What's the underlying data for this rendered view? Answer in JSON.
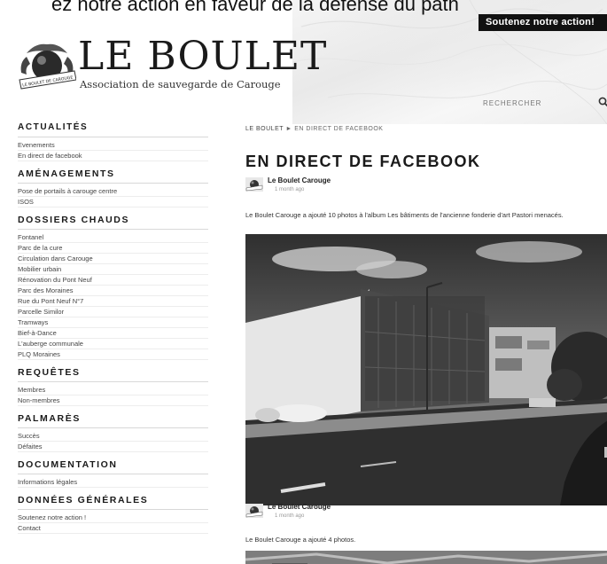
{
  "header": {
    "top_caption": "ez notre action en faveur de la défense du path",
    "support_button": "Soutenez notre action!",
    "logo_title": "LE BOULET",
    "logo_subtitle": "Association de sauvegarde de Carouge",
    "search_placeholder": "RECHERCHER",
    "seal_text": "LE BOULET DE CAROUGE"
  },
  "sidebar": {
    "sections": [
      {
        "title": "ACTUALITÉS",
        "items": [
          "Evenements",
          "En direct de facebook"
        ]
      },
      {
        "title": "AMÉNAGEMENTS",
        "items": [
          "Pose de portails à carouge centre",
          "ISOS"
        ]
      },
      {
        "title": "DOSSIERS CHAUDS",
        "items": [
          "Fontanel",
          "Parc de la cure",
          "Circulation dans Carouge",
          "Mobilier urbain",
          "Rénovation du Pont Neuf",
          "Parc des Moraines",
          "Rue du Pont Neuf N°7",
          "Parcelle Similor",
          "Tramways",
          "Bief-à-Dance",
          "L'auberge communale",
          "PLQ Moraines"
        ]
      },
      {
        "title": "REQUÊTES",
        "items": [
          "Membres",
          "Non-membres"
        ]
      },
      {
        "title": "PALMARÈS",
        "items": [
          "Succès",
          "Défaites"
        ]
      },
      {
        "title": "DOCUMENTATION",
        "items": [
          "Informations légales"
        ]
      },
      {
        "title": "DONNÉES GÉNÉRALES",
        "items": [
          "Soutenez notre action !",
          "Contact"
        ]
      }
    ]
  },
  "main": {
    "breadcrumb_home": "LE BOULET",
    "breadcrumb_sep": "►",
    "breadcrumb_current": "EN DIRECT DE FACEBOOK",
    "title": "EN DIRECT DE FACEBOOK",
    "posts": [
      {
        "author": "Le Boulet Carouge",
        "time": "1 month ago",
        "text": "Le Boulet Carouge a ajouté 10 photos à l'album Les bâtiments de l'ancienne fonderie d'art Pastori menacés."
      },
      {
        "author": "Le Boulet Carouge",
        "time": "1 month ago",
        "text": "Le Boulet Carouge a ajouté 4 photos."
      }
    ]
  },
  "colors": {
    "button_bg": "#111111",
    "text": "#222222",
    "accent_rule": "#d8d8d8"
  }
}
